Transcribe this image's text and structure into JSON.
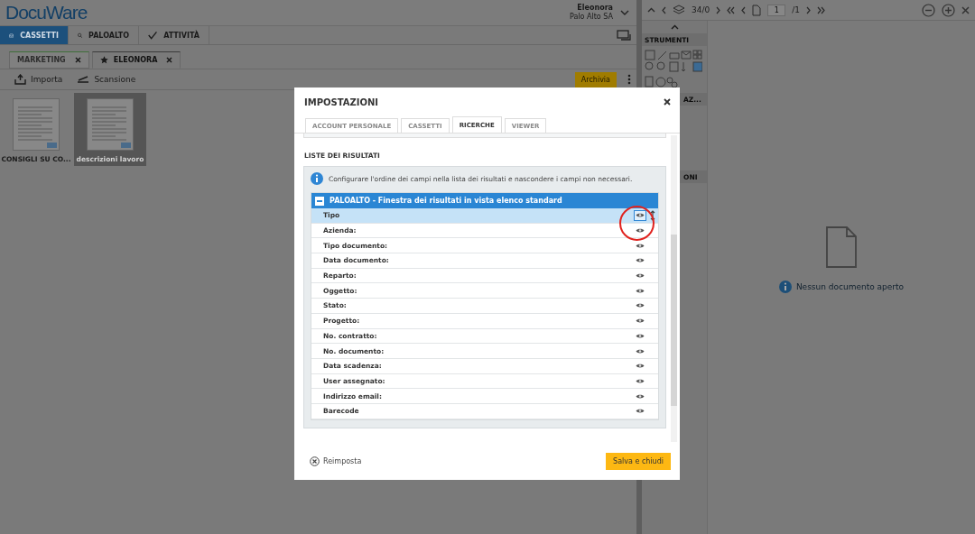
{
  "header": {
    "logo": "DocuWare",
    "user_name": "Eleonora",
    "organization": "Palo Alto SA"
  },
  "nav": [
    {
      "label": "CASSETTI",
      "selected": true
    },
    {
      "label": "PALOALTO",
      "selected": false
    },
    {
      "label": "ATTIVITÀ",
      "selected": false
    }
  ],
  "cabinet_tabs": [
    {
      "label": "MARKETING",
      "starred": false,
      "selected": false
    },
    {
      "label": "ELEONORA",
      "starred": true,
      "selected": true
    }
  ],
  "toolbar": {
    "import": "Importa",
    "scan": "Scansione",
    "archive": "Archivia"
  },
  "documents": [
    {
      "title": "CONSIGLI SU CO...",
      "selected": false
    },
    {
      "title": "descrizioni lavoro",
      "selected": true
    }
  ],
  "viewer": {
    "counter": "34/0",
    "page": "1",
    "page_total": "/1",
    "panels": [
      "STRUMENTI",
      "AZ...",
      "ONI"
    ],
    "empty_message": "Nessun documento aperto"
  },
  "dialog": {
    "title": "IMPOSTAZIONI",
    "tabs": [
      {
        "label": "ACCOUNT PERSONALE",
        "selected": false
      },
      {
        "label": "CASSETTI",
        "selected": false
      },
      {
        "label": "RICERCHE",
        "selected": true
      },
      {
        "label": "VIEWER",
        "selected": false
      }
    ],
    "section_title": "LISTE DEI RISULTATI",
    "info": "Configurare l'ordine dei campi nella lista dei risultati e nascondere i campi non necessari.",
    "group": {
      "title": "PALOALTO - Finestra dei risultati in vista elenco standard",
      "expanded": true,
      "fields": [
        {
          "label": "Tipo",
          "selected": true
        },
        {
          "label": "Azienda:",
          "selected": false
        },
        {
          "label": "Tipo documento:",
          "selected": false
        },
        {
          "label": "Data documento:",
          "selected": false
        },
        {
          "label": "Reparto:",
          "selected": false
        },
        {
          "label": "Oggetto:",
          "selected": false
        },
        {
          "label": "Stato:",
          "selected": false
        },
        {
          "label": "Progetto:",
          "selected": false
        },
        {
          "label": "No. contratto:",
          "selected": false
        },
        {
          "label": "No. documento:",
          "selected": false
        },
        {
          "label": "Data scadenza:",
          "selected": false
        },
        {
          "label": "User assegnato:",
          "selected": false
        },
        {
          "label": "Indirizzo email:",
          "selected": false
        },
        {
          "label": "Barecode",
          "selected": false
        }
      ]
    },
    "reset": "Reimposta",
    "save": "Salva e chiudi"
  }
}
